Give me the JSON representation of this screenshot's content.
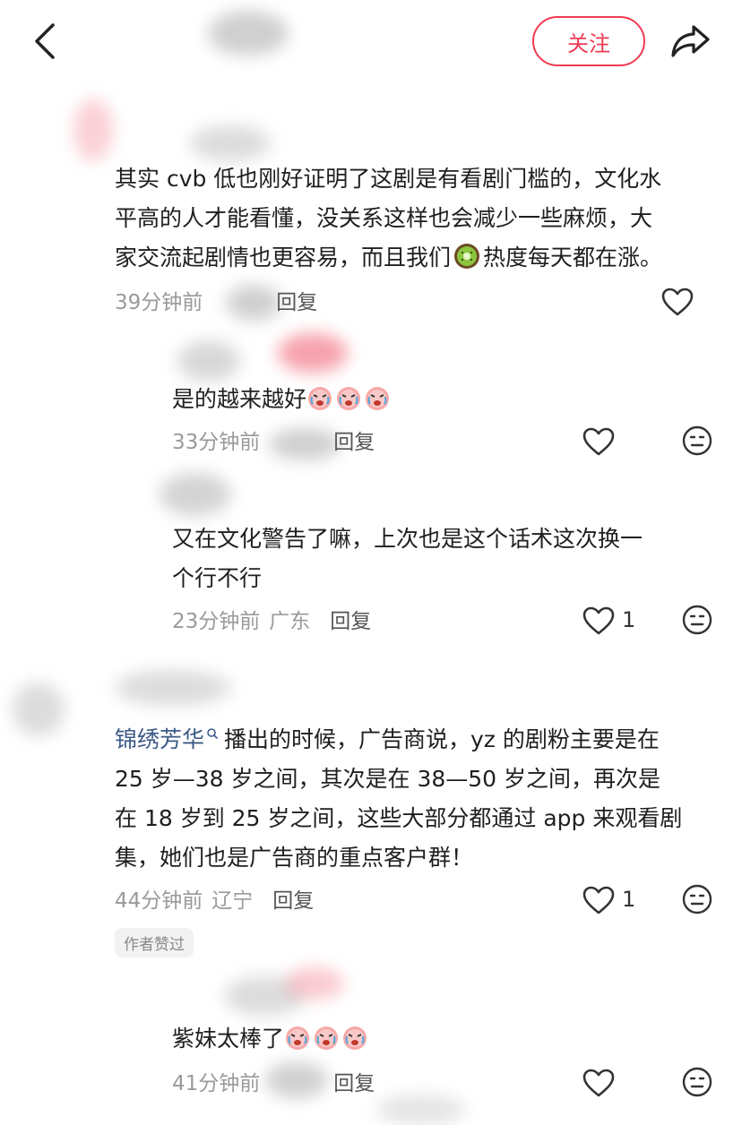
{
  "header": {
    "follow_label": "关注"
  },
  "comments": [
    {
      "text_lines": [
        "其实 cvb 低也刚好证明了这剧是有看剧门槛的，文化水",
        "平高的人才能看懂，没关系这样也会减少一些麻烦，大"
      ],
      "text_line3_pre": "家交流起剧情也更容易，而且我们",
      "text_line3_post": "热度每天都在涨。",
      "time": "39分钟前",
      "reply": "回复"
    },
    {
      "text": "是的越来越好",
      "time": "33分钟前",
      "reply": "回复"
    },
    {
      "text_lines": [
        "又在文化警告了嘛，上次也是这个话术这次换一",
        "个行不行"
      ],
      "time": "23分钟前",
      "location": "广东",
      "reply": "回复",
      "likes": "1"
    },
    {
      "username": "锦绣芳华",
      "text_line1": "播出的时候，广告商说，yz 的剧粉主要是在",
      "text_lines": [
        "25 岁—38 岁之间，其次是在 38—50 岁之间，再次是",
        "在 18 岁到 25 岁之间，这些大部分都通过 app 来观看剧",
        "集，她们也是广告商的重点客户群！"
      ],
      "time": "44分钟前",
      "location": "辽宁",
      "reply": "回复",
      "likes": "1",
      "badge": "作者赞过"
    },
    {
      "text": "紫妹太棒了",
      "time": "41分钟前",
      "reply": "回复"
    }
  ]
}
